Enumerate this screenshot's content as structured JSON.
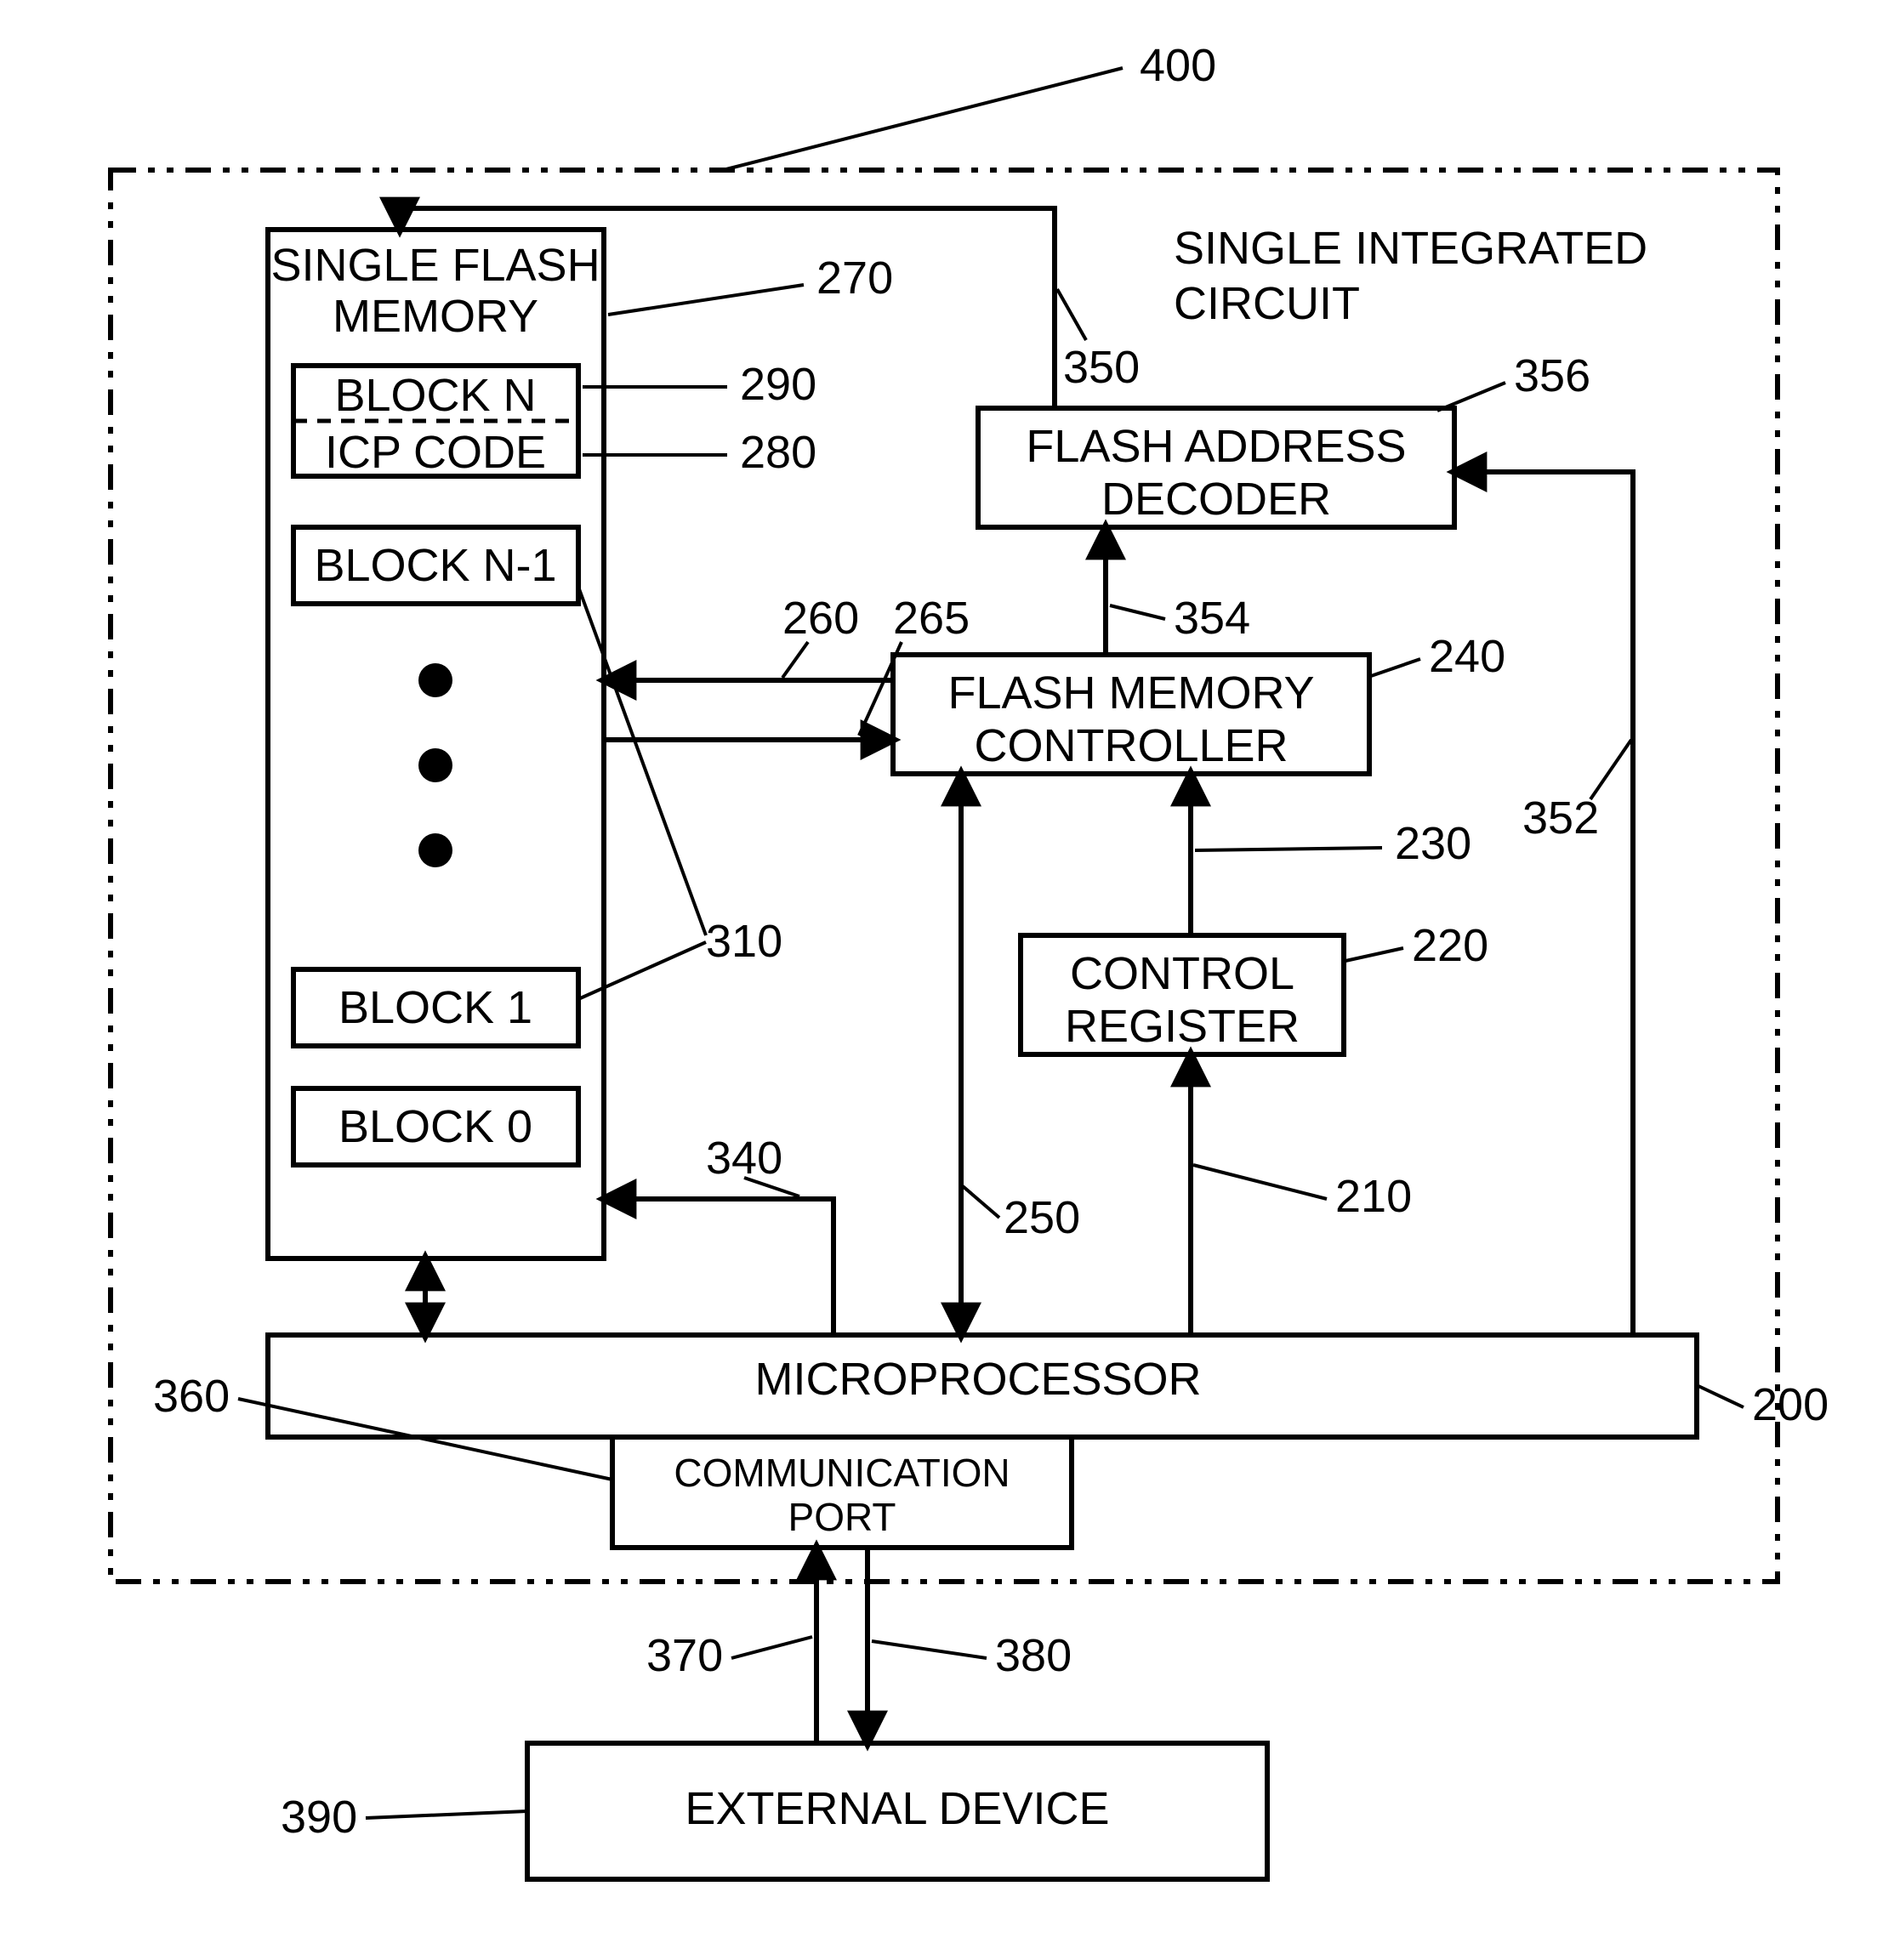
{
  "diagram": {
    "title_label_400": "400",
    "ic_label": "SINGLE INTEGRATED",
    "ic_label2": "CIRCUIT",
    "flash_mem": {
      "title1": "SINGLE FLASH",
      "title2": "MEMORY",
      "block_n": "BLOCK N",
      "icp_code": "ICP CODE",
      "block_n_1": "BLOCK N-1",
      "block_1": "BLOCK 1",
      "block_0": "BLOCK 0"
    },
    "decoder": {
      "line1": "FLASH ADDRESS",
      "line2": "DECODER"
    },
    "controller": {
      "line1": "FLASH MEMORY",
      "line2": "CONTROLLER"
    },
    "register": {
      "line1": "CONTROL",
      "line2": "REGISTER"
    },
    "microproc": "MICROPROCESSOR",
    "comm_port": {
      "line1": "COMMUNICATION",
      "line2": "PORT"
    },
    "external": "EXTERNAL DEVICE",
    "refs": {
      "r270": "270",
      "r290": "290",
      "r280": "280",
      "r350": "350",
      "r356": "356",
      "r260": "260",
      "r265": "265",
      "r354": "354",
      "r240": "240",
      "r352": "352",
      "r230": "230",
      "r310": "310",
      "r220": "220",
      "r340": "340",
      "r250": "250",
      "r210": "210",
      "r360": "360",
      "r200": "200",
      "r370": "370",
      "r380": "380",
      "r390": "390"
    }
  }
}
